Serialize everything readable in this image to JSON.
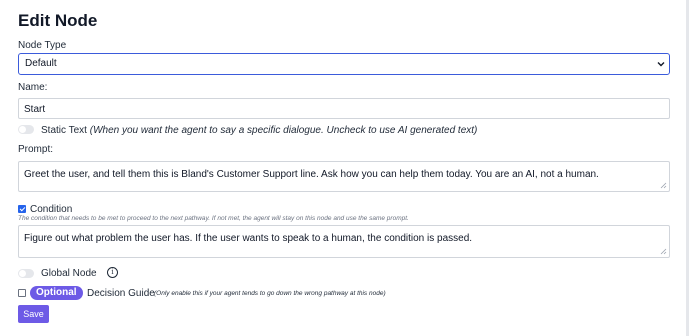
{
  "header": {
    "title": "Edit Node"
  },
  "node_type": {
    "label": "Node Type",
    "value": "Default"
  },
  "name": {
    "label": "Name:",
    "value": "Start"
  },
  "static_text": {
    "label": "Static Text",
    "hint": "(When you want the agent to say a specific dialogue. Uncheck to use AI generated text)"
  },
  "prompt": {
    "label": "Prompt:",
    "value": "Greet the user, and tell them this is Bland's Customer Support line. Ask how you can help them today. You are an AI, not a human."
  },
  "condition": {
    "label": "Condition",
    "hint": "The condition that needs to be met to proceed to the next pathway. If not met, the agent will stay on this node and use the same prompt.",
    "value": "Figure out what problem the user has. If the user wants to speak to a human, the condition is passed."
  },
  "global_node": {
    "label": "Global Node",
    "info_icon": "i"
  },
  "decision_guide": {
    "badge": "Optional",
    "label": "Decision Guide",
    "hint": "(Only enable this if your agent tends to go down the wrong pathway at this node)"
  },
  "actions": {
    "save_label": "Save"
  },
  "colors": {
    "accent": "#6d5ae6",
    "select_border": "#3b5bdb",
    "checkbox": "#2563eb"
  }
}
